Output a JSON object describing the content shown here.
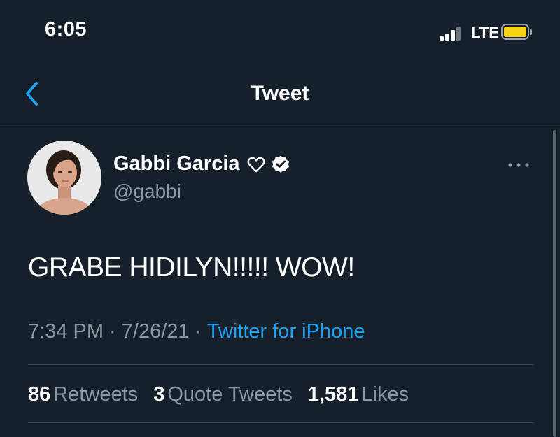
{
  "status_bar": {
    "time": "6:05",
    "network": "LTE",
    "signal_bars_filled": 3,
    "signal_bars_total": 4,
    "battery_color": "#f7d316",
    "icons": [
      "signal-icon",
      "battery-icon"
    ]
  },
  "header": {
    "title": "Tweet",
    "back_icon": "chevron-left-icon"
  },
  "tweet": {
    "author_name": "Gabbi Garcia",
    "author_handle": "@gabbi",
    "name_icons": [
      "heart-outline-icon",
      "verified-badge-icon"
    ],
    "text": "GRABE HIDILYN!!!!! WOW!",
    "time": "7:34 PM",
    "date": "7/26/21",
    "separator": " · ",
    "source": "Twitter for iPhone",
    "more_icon": "more-horizontal-icon"
  },
  "stats": [
    {
      "count": "86",
      "label": "Retweets"
    },
    {
      "count": "3",
      "label": "Quote Tweets"
    },
    {
      "count": "1,581",
      "label": "Likes"
    }
  ],
  "colors": {
    "background": "#15202b",
    "accent": "#1da1f2",
    "secondary_text": "#8899a6",
    "divider": "#38444d"
  }
}
